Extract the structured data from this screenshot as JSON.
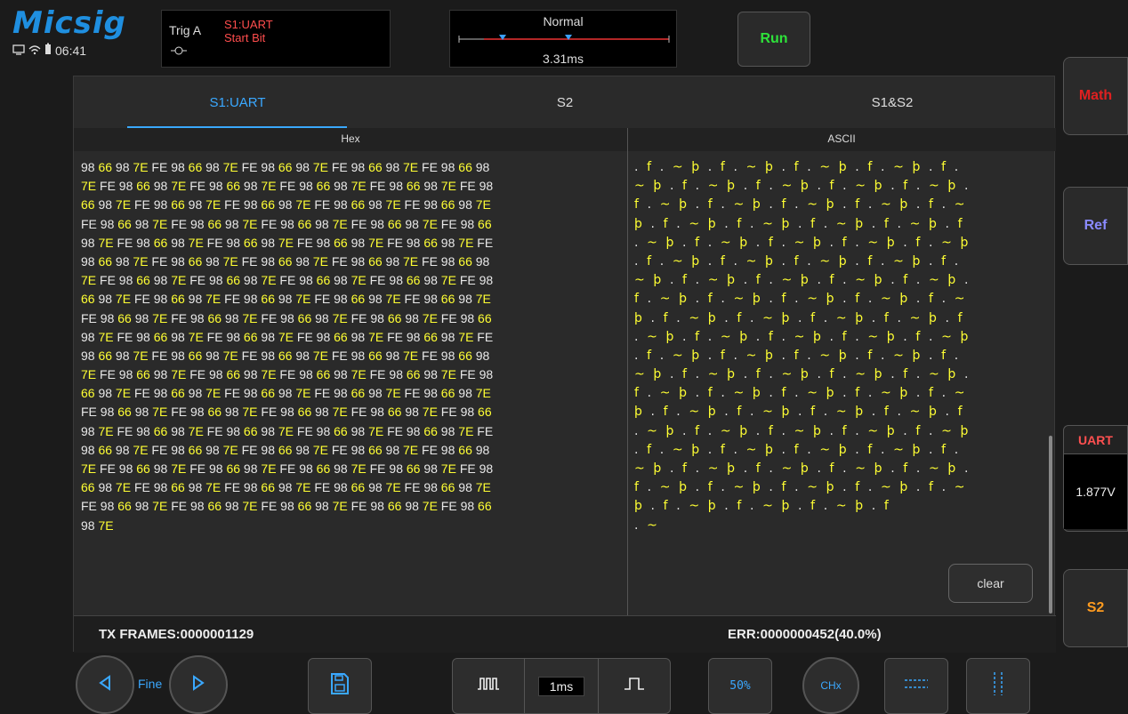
{
  "brand": "Micsig",
  "status": {
    "time": "06:41"
  },
  "trigger": {
    "label": "Trig",
    "source": "A",
    "line1": "S1:UART",
    "line2": "Start Bit"
  },
  "timebase": {
    "mode": "Normal",
    "position": "3.31ms"
  },
  "run_label": "Run",
  "side": {
    "math": "Math",
    "ref": "Ref",
    "uart": "UART",
    "voltage": "1.877V",
    "s2": "S2"
  },
  "tabs": [
    "S1:UART",
    "S2",
    "S1&S2"
  ],
  "columns": {
    "hex": "Hex",
    "ascii": "ASCII"
  },
  "hex_rows": [
    "98 66 98 7E FE 98 66 98 7E FE 98 66 98 7E FE 98 66 98 7E FE 98 66 98",
    "7E FE 98 66 98 7E FE 98 66 98 7E FE 98 66 98 7E FE 98 66 98 7E FE 98",
    "66 98 7E FE 98 66 98 7E FE 98 66 98 7E FE 98 66 98 7E FE 98 66 98 7E",
    "FE 98 66 98 7E FE 98 66 98 7E FE 98 66 98 7E FE 98 66 98 7E FE 98 66",
    "98 7E FE 98 66 98 7E FE 98 66 98 7E FE 98 66 98 7E FE 98 66 98 7E FE",
    "98 66 98 7E FE 98 66 98 7E FE 98 66 98 7E FE 98 66 98 7E FE 98 66 98",
    "7E FE 98 66 98 7E FE 98 66 98 7E FE 98 66 98 7E FE 98 66 98 7E FE 98",
    "66 98 7E FE 98 66 98 7E FE 98 66 98 7E FE 98 66 98 7E FE 98 66 98 7E",
    "FE 98 66 98 7E FE 98 66 98 7E FE 98 66 98 7E FE 98 66 98 7E FE 98 66",
    "98 7E FE 98 66 98 7E FE 98 66 98 7E FE 98 66 98 7E FE 98 66 98 7E FE",
    "98 66 98 7E FE 98 66 98 7E FE 98 66 98 7E FE 98 66 98 7E FE 98 66 98",
    "7E FE 98 66 98 7E FE 98 66 98 7E FE 98 66 98 7E FE 98 66 98 7E FE 98",
    "66 98 7E FE 98 66 98 7E FE 98 66 98 7E FE 98 66 98 7E FE 98 66 98 7E",
    "FE 98 66 98 7E FE 98 66 98 7E FE 98 66 98 7E FE 98 66 98 7E FE 98 66",
    "98 7E FE 98 66 98 7E FE 98 66 98 7E FE 98 66 98 7E FE 98 66 98 7E FE",
    "98 66 98 7E FE 98 66 98 7E FE 98 66 98 7E FE 98 66 98 7E FE 98 66 98",
    "7E FE 98 66 98 7E FE 98 66 98 7E FE 98 66 98 7E FE 98 66 98 7E FE 98",
    "66 98 7E FE 98 66 98 7E FE 98 66 98 7E FE 98 66 98 7E FE 98 66 98 7E",
    "FE 98 66 98 7E FE 98 66 98 7E FE 98 66 98 7E FE 98 66 98 7E FE 98 66",
    "98 7E"
  ],
  "ascii_rows": [
    ". f . ~ þ . f . ~ þ . f . ~ þ . f . ~ þ . f .",
    "~ þ . f . ~ þ . f . ~ þ . f . ~ þ . f . ~ þ .",
    "f . ~ þ . f . ~ þ . f . ~ þ . f . ~ þ . f . ~",
    "þ . f . ~ þ . f . ~ þ . f . ~ þ . f . ~ þ . f",
    ". ~ þ . f . ~ þ . f . ~ þ . f . ~ þ . f . ~ þ",
    ". f . ~ þ . f . ~ þ . f . ~ þ . f . ~ þ . f .",
    "~ þ . f . ~ þ . f . ~ þ . f . ~ þ . f . ~ þ .",
    "f . ~ þ . f . ~ þ . f . ~ þ . f . ~ þ . f . ~",
    "þ . f . ~ þ . f . ~ þ . f . ~ þ . f . ~ þ . f",
    ". ~ þ . f . ~ þ . f . ~ þ . f . ~ þ . f . ~ þ",
    ". f . ~ þ . f . ~ þ . f . ~ þ . f . ~ þ . f .",
    "~ þ . f . ~ þ . f . ~ þ . f . ~ þ . f . ~ þ .",
    "f . ~ þ . f . ~ þ . f . ~ þ . f . ~ þ . f . ~",
    "þ . f . ~ þ . f . ~ þ . f . ~ þ . f . ~ þ . f",
    ". ~ þ . f . ~ þ . f . ~ þ . f . ~ þ . f . ~ þ",
    ". f . ~ þ . f . ~ þ . f . ~ þ . f . ~ þ . f .",
    "~ þ . f . ~ þ . f . ~ þ . f . ~ þ . f . ~ þ .",
    "f . ~ þ . f . ~ þ . f . ~ þ . f . ~ þ . f . ~",
    "þ . f . ~ þ . f . ~ þ . f . ~ þ . f",
    ". ~"
  ],
  "clear_label": "clear",
  "footer": {
    "tx_frames": "TX FRAMES:0000001129",
    "err": "ERR:0000000452(40.0%)"
  },
  "bottom": {
    "fine": "Fine",
    "time_scale": "1ms",
    "fifty": "50%",
    "chx": "CHx"
  },
  "colors": {
    "accent": "#1f8fe0",
    "highlight": "#ffff33",
    "run": "#2ee23a",
    "math": "#e02020",
    "ref": "#8a8aff",
    "uart": "#ff5050",
    "s2": "#ff9b1f"
  }
}
